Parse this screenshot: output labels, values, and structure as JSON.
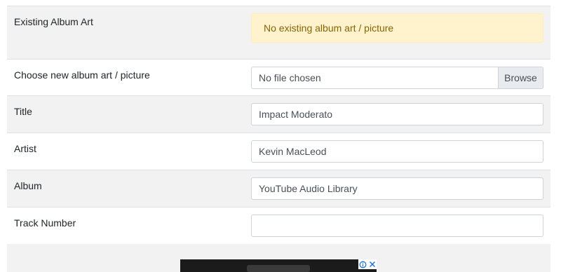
{
  "form": {
    "existing_art": {
      "label": "Existing Album Art",
      "alert_text": "No existing album art / picture"
    },
    "new_art": {
      "label": "Choose new album art / picture",
      "file_status": "No file chosen",
      "browse_label": "Browse"
    },
    "title": {
      "label": "Title",
      "value": "Impact Moderato"
    },
    "artist": {
      "label": "Artist",
      "value": "Kevin MacLeod"
    },
    "album": {
      "label": "Album",
      "value": "YouTube Audio Library"
    },
    "track_number": {
      "label": "Track Number",
      "value": ""
    }
  },
  "ad": {
    "icons": [
      "adchoices-icon",
      "close-icon"
    ],
    "accent_color": "#1a73e8"
  },
  "colors": {
    "stripe": "#f2f2f2",
    "border": "#dee2e6",
    "alert_bg": "#fff3cd",
    "alert_text": "#856404"
  }
}
